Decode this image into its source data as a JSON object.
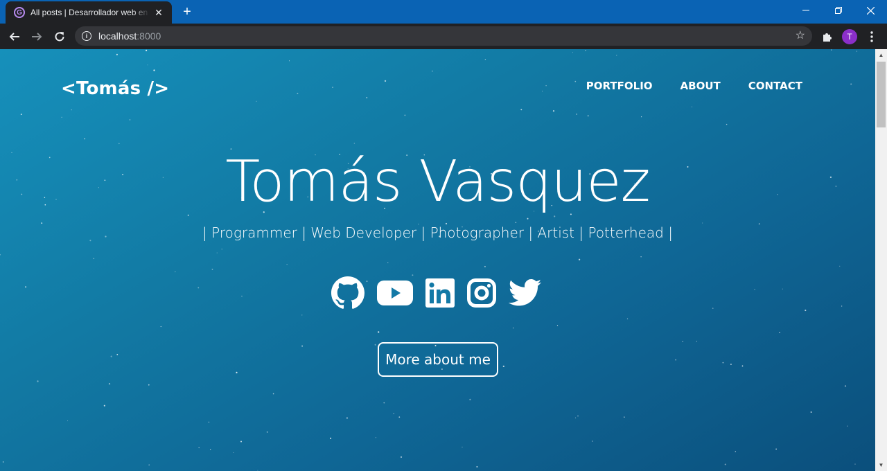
{
  "browser": {
    "tab_title": "All posts | Desarrollador web en la",
    "tab_favicon": "G",
    "new_tab_label": "+",
    "url_host": "localhost",
    "url_port": ":8000",
    "avatar_letter": "T"
  },
  "site": {
    "logo": "<Tomás />",
    "nav": [
      "PORTFOLIO",
      "ABOUT",
      "CONTACT"
    ],
    "name": "Tomás Vasquez",
    "tagline": "| Programmer | Web Developer | Photographer | Artist | Potterhead |",
    "socials": [
      "github-icon",
      "youtube-icon",
      "linkedin-icon",
      "instagram-icon",
      "twitter-icon"
    ],
    "cta": "More about me"
  },
  "colors": {
    "tabbar": "#0a63b4",
    "toolbar": "#202124",
    "gradient_start": "#1690bb",
    "gradient_end": "#0b4f7c"
  }
}
